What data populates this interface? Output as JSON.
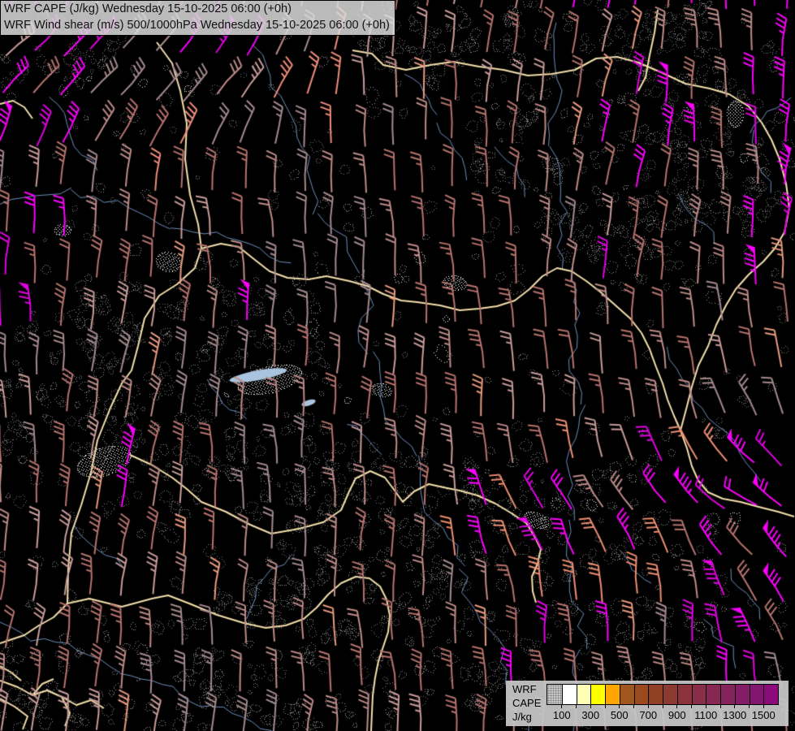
{
  "header": {
    "line1": "WRF CAPE (J/kg) Wednesday 15-10-2025 06:00 (+0h)",
    "line2": "WRF Wind shear (m/s) 500/1000hPa Wednesday 15-10-2025 06:00 (+0h)"
  },
  "legend": {
    "model": "WRF",
    "variable": "CAPE",
    "unit": "J/kg",
    "bin_colors": [
      "pattern",
      "#ffffff",
      "#ffffb4",
      "#ffff00",
      "#ffa500",
      "#a0561e",
      "#9a4a1e",
      "#914026",
      "#8c3a30",
      "#8a333c",
      "#882e48",
      "#862852",
      "#84235c",
      "#831e66",
      "#811770",
      "#8c0b7c"
    ],
    "tick_values": [
      100,
      300,
      500,
      700,
      900,
      1100,
      1300,
      1500
    ]
  },
  "map": {
    "background_color": "#000000",
    "contour_dot_color": "#8a8a8a",
    "cape_patch_color": "#ffffff",
    "border_color": "#f3dfab",
    "river_color": "#6e8fbf",
    "lake_color": "#a9c4de",
    "barb_palette": {
      "mauve": "#a5898d",
      "rosy": "#bd8b88",
      "brick": "#b7736e",
      "pale_rose": "#c99c9a",
      "salmon": "#ee8e72",
      "salmon2": "#ef8d7b",
      "magenta": "#fb00fb",
      "magenta2": "#e300e3"
    }
  }
}
